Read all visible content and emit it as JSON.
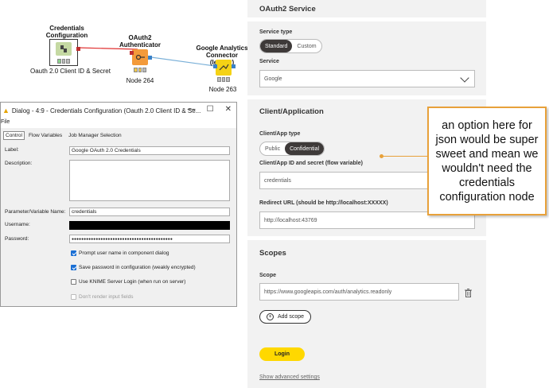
{
  "workflow": {
    "nodes": [
      {
        "title": "Credentials\nConfiguration",
        "label": "Oauth 2.0 Client ID & Secret",
        "color": "#c5d9a3"
      },
      {
        "title": "OAuth2\nAuthenticator",
        "label": "Node 264",
        "color": "#f39a3a"
      },
      {
        "title": "Google Analytics\nConnector (legacy)",
        "label": "Node 263",
        "color": "#f5d215"
      }
    ],
    "node_icons": [
      "credentials-node-icon",
      "key-icon",
      "analytics-icon"
    ],
    "connection_colors": {
      "credentials": "#e03030",
      "auth": "#7ab0d8"
    }
  },
  "dialog": {
    "title": "Dialog - 4:9 - Credentials Configuration (Oauth 2.0 Client ID & Se...",
    "menu": "File",
    "tabs": [
      "Control",
      "Flow Variables",
      "Job Manager Selection"
    ],
    "label_caption": "Label:",
    "label_value": "Google OAuth 2.0 Credentials",
    "description_caption": "Description:",
    "description_value": "",
    "param_caption": "Parameter/Variable Name:",
    "param_value": "credentials",
    "username_caption": "Username:",
    "password_caption": "Password:",
    "password_value": "●●●●●●●●●●●●●●●●●●●●●●●●●●●●●●●●●●●●●●●●●●",
    "checkboxes": [
      {
        "label": "Prompt user name in component dialog",
        "checked": true
      },
      {
        "label": "Save password in configuration (weakly encrypted)",
        "checked": true
      },
      {
        "label": "Use KNIME Server Login (when run on server)",
        "checked": false
      },
      {
        "label": "Don't render input fields",
        "checked": false,
        "disabled": true
      }
    ]
  },
  "settings": {
    "oauth_section": "OAuth2 Service",
    "service_type_label": "Service type",
    "service_type_options": [
      "Standard",
      "Custom"
    ],
    "service_type_selected": "Standard",
    "service_label": "Service",
    "service_value": "Google",
    "client_section": "Client/Application",
    "client_type_label": "Client/App type",
    "client_type_options": [
      "Public",
      "Confidential"
    ],
    "client_type_selected": "Confidential",
    "client_id_label": "Client/App ID and secret (flow variable)",
    "client_id_value": "credentials",
    "redirect_label": "Redirect URL (should be http://localhost:XXXXX)",
    "redirect_value": "http://localhost:43769",
    "scopes_section": "Scopes",
    "scope_label": "Scope",
    "scope_value": "https://www.googleapis.com/auth/analytics.readonly",
    "add_scope_label": "Add scope",
    "login_label": "Login",
    "advanced_link": "Show advanced settings"
  },
  "callout": {
    "text": "an  option here for json would be super sweet and mean we wouldn't need the credentials configuration node",
    "border_color": "#e8a13a"
  }
}
